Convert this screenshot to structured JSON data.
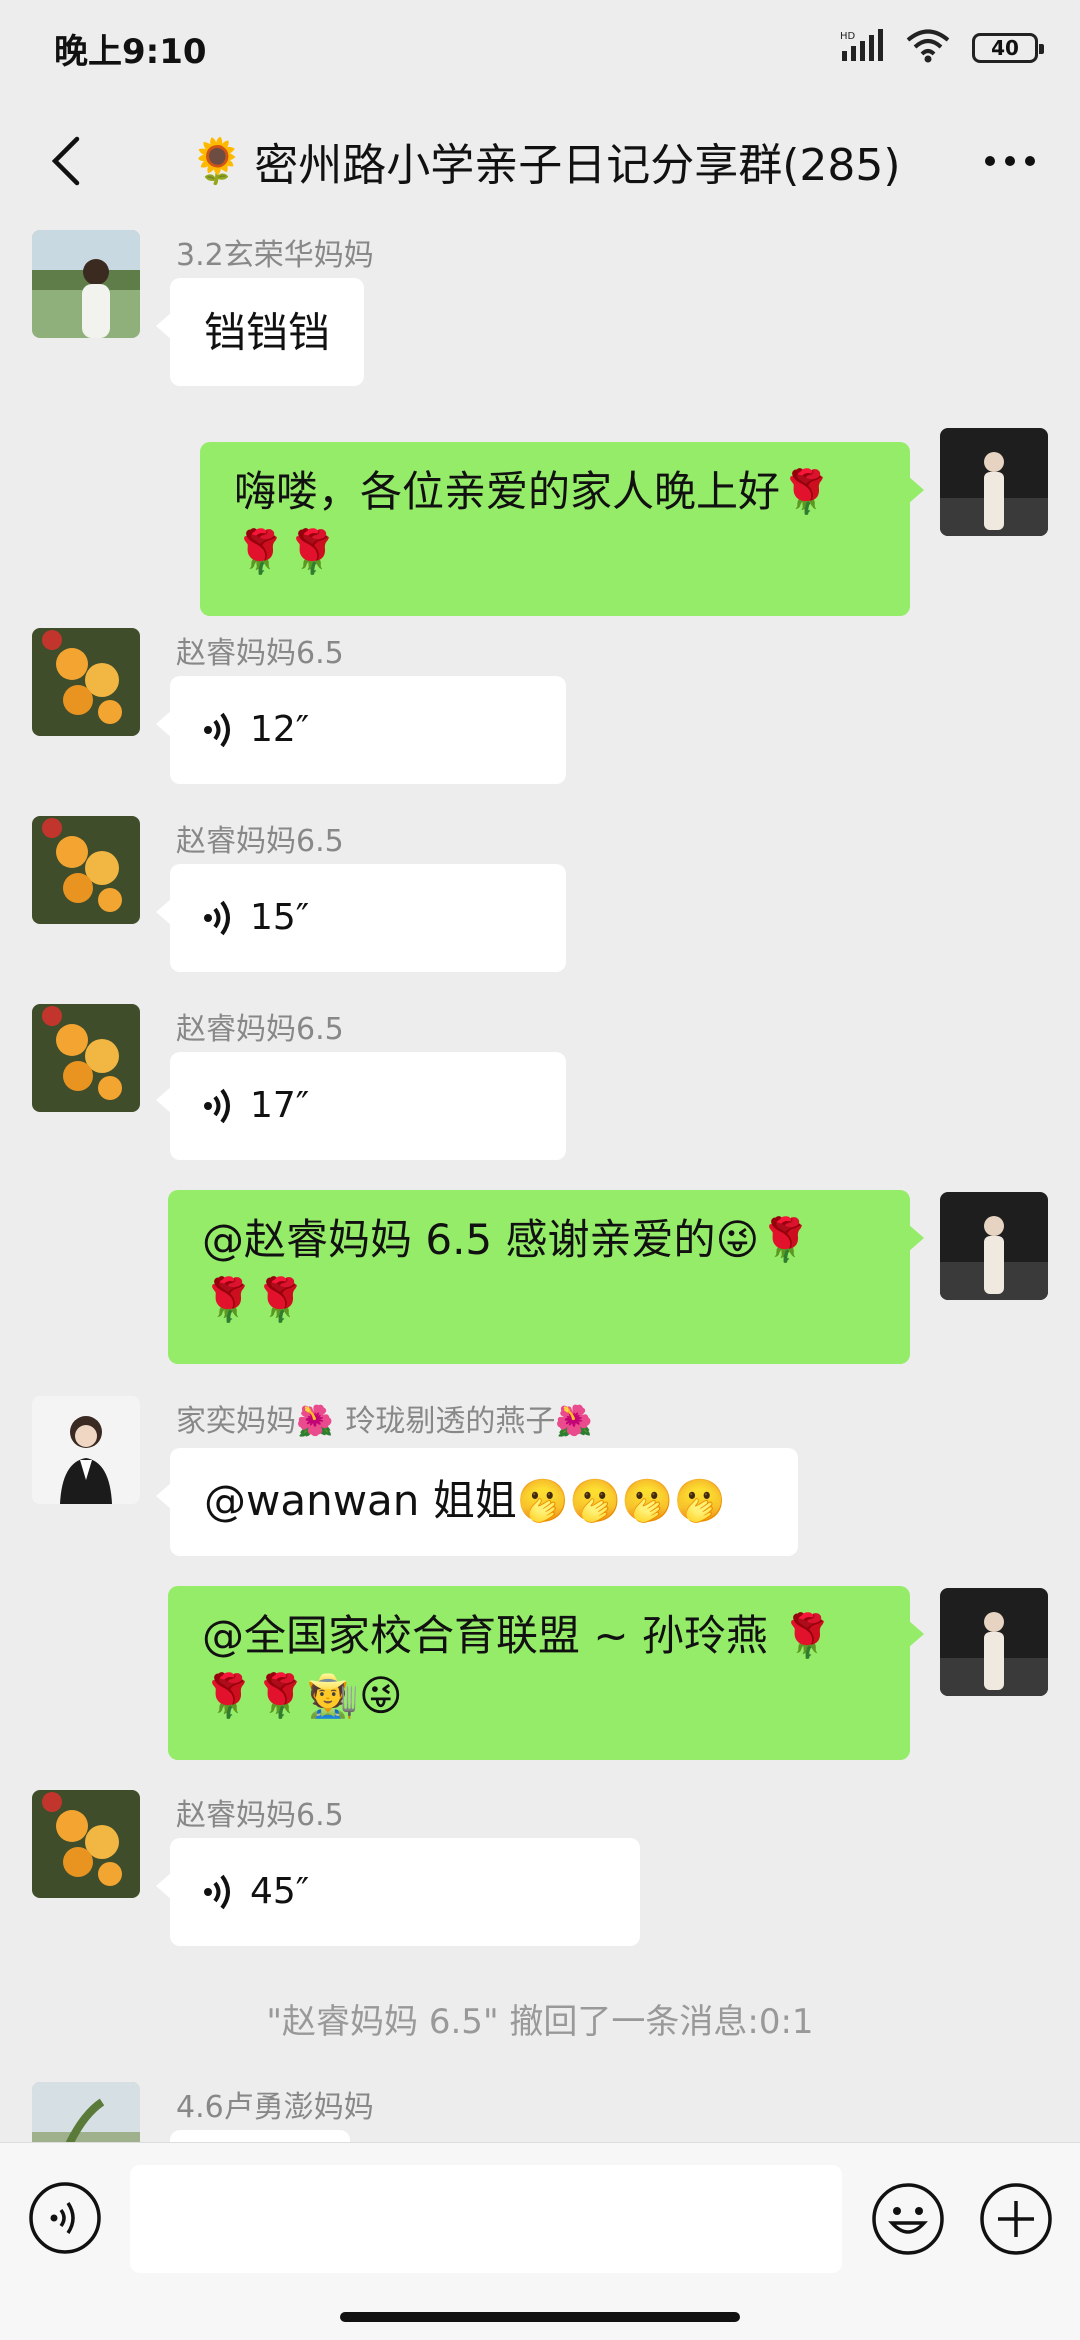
{
  "status_bar": {
    "time": "晚上9:10",
    "battery": "40",
    "network_label": "HD"
  },
  "nav": {
    "title_emoji": "🌻",
    "title": "密州路小学亲子日记分享群(285)"
  },
  "messages": [
    {
      "sender": "3.2玄荣华妈妈",
      "text": "铛铛铛"
    },
    {
      "text_line1": "嗨喽，各位亲爱的家人晚上好🌹",
      "text_line2": "🌹🌹"
    },
    {
      "sender": "赵睿妈妈6.5",
      "voice_duration": "12″"
    },
    {
      "sender": "赵睿妈妈6.5",
      "voice_duration": "15″"
    },
    {
      "sender": "赵睿妈妈6.5",
      "voice_duration": "17″"
    },
    {
      "text_line1": "@赵睿妈妈 6.5  感谢亲爱的😜🌹",
      "text_line2": "🌹🌹"
    },
    {
      "sender_a": "家奕妈妈🌺",
      "sender_b": "玲珑剔透的燕子🌺",
      "text": "@wanwan  姐姐🫢🫢🫢🫢"
    },
    {
      "text_line1": "@全国家校合育联盟 ~ 孙玲燕  🌹",
      "text_line2": "🌹🌹🧑‍🌾😜"
    },
    {
      "sender": "赵睿妈妈6.5",
      "voice_duration": "45″"
    },
    {
      "system": "\"赵睿妈妈 6.5\" 撤回了一条消息:0:1"
    },
    {
      "sender": "4.6卢勇澎妈妈"
    }
  ],
  "colors": {
    "background": "#ededed",
    "green_bubble": "#95ec69",
    "white_bubble": "#ffffff"
  },
  "input": {
    "placeholder": ""
  }
}
